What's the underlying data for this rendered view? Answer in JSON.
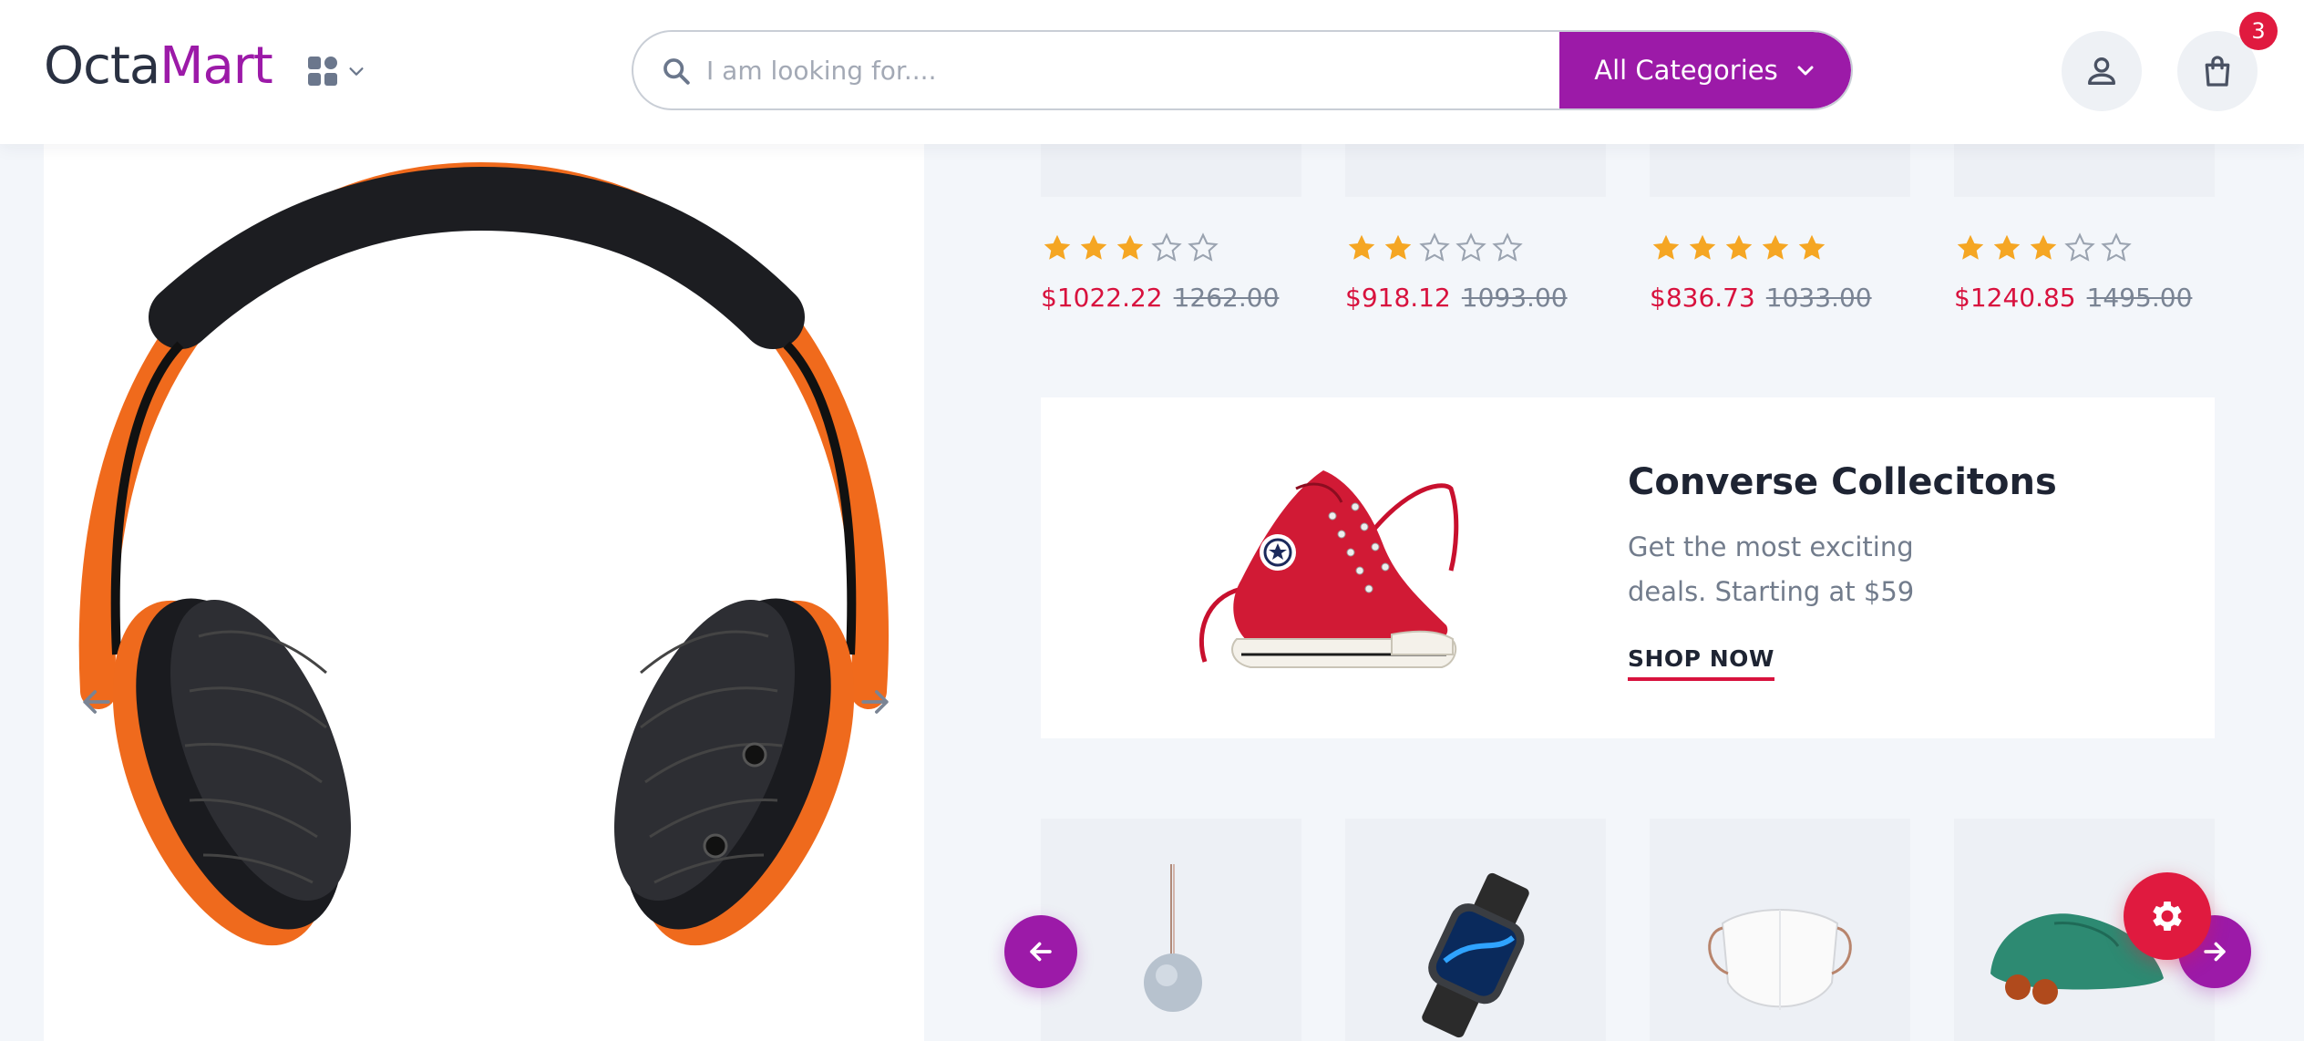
{
  "header": {
    "logo_part1": "Octa",
    "logo_part2": "Mart",
    "search_placeholder": "I am looking for....",
    "category_button": "All Categories",
    "cart_count": "3"
  },
  "products_top": [
    {
      "rating": 3,
      "price": "$1022.22",
      "old_price": "1262.00"
    },
    {
      "rating": 2,
      "price": "$918.12",
      "old_price": "1093.00"
    },
    {
      "rating": 5,
      "price": "$836.73",
      "old_price": "1033.00"
    },
    {
      "rating": 3,
      "price": "$1240.85",
      "old_price": "1495.00"
    }
  ],
  "banner": {
    "title": "Converse Collecitons",
    "description": "Get the most exciting deals. Starting at $59",
    "cta": "SHOP NOW"
  },
  "products_bottom": [
    "pendant-image",
    "smartwatch-image",
    "face-mask-image",
    "shoe-image"
  ],
  "colors": {
    "brand": "#9c1aa8",
    "accent_red": "#e01a3f",
    "price_red": "#d8123e",
    "star": "#f5a623"
  },
  "icons": [
    "grid-icon",
    "chevron-down-icon",
    "search-icon",
    "user-icon",
    "shopping-bag-icon",
    "arrow-left-icon",
    "arrow-right-icon",
    "gear-icon"
  ]
}
